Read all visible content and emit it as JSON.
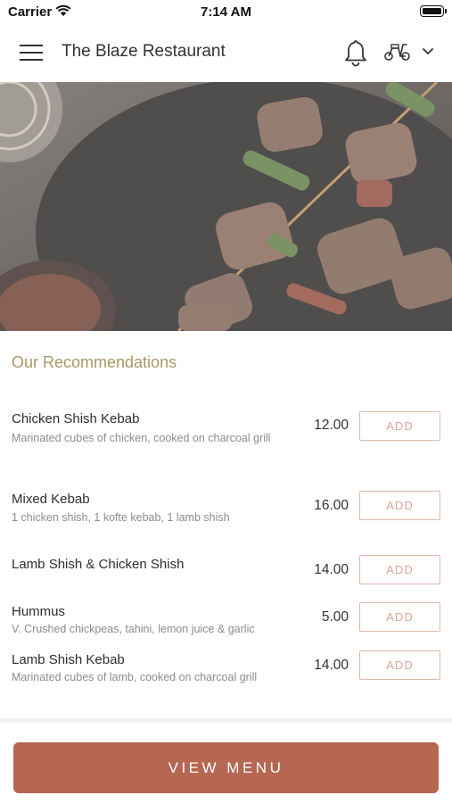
{
  "status_bar": {
    "carrier": "Carrier",
    "time": "7:14 AM"
  },
  "header": {
    "title": "The Blaze Restaurant",
    "icons": [
      "menu-icon",
      "bell-icon",
      "scooter-icon",
      "chevron-down-icon"
    ]
  },
  "hero": {
    "image": "skewered grilled meat kebabs with peppers and onions"
  },
  "recommendations": {
    "title": "Our Recommendations",
    "items": [
      {
        "name": "Chicken Shish Kebab",
        "description": "Marinated cubes of chicken, cooked on charcoal grill",
        "price": "12.00",
        "button": "ADD"
      },
      {
        "name": "Mixed Kebab",
        "description": "1 chicken shish, 1 kofte kebab, 1 lamb shish",
        "price": "16.00",
        "button": "ADD"
      },
      {
        "name": "Lamb Shish & Chicken Shish",
        "description": "",
        "price": "14.00",
        "button": "ADD"
      },
      {
        "name": "Hummus",
        "description": "V. Crushed chickpeas, tahini, lemon juice & garlic",
        "price": "5.00",
        "button": "ADD"
      },
      {
        "name": "Lamb Shish Kebab",
        "description": "Marinated cubes of lamb, cooked on charcoal grill",
        "price": "14.00",
        "button": "ADD"
      }
    ]
  },
  "footer": {
    "view_menu": "VIEW MENU"
  },
  "colors": {
    "accent": "#b56752",
    "section_title": "#a99767",
    "add_border": "#e0b7ab"
  }
}
